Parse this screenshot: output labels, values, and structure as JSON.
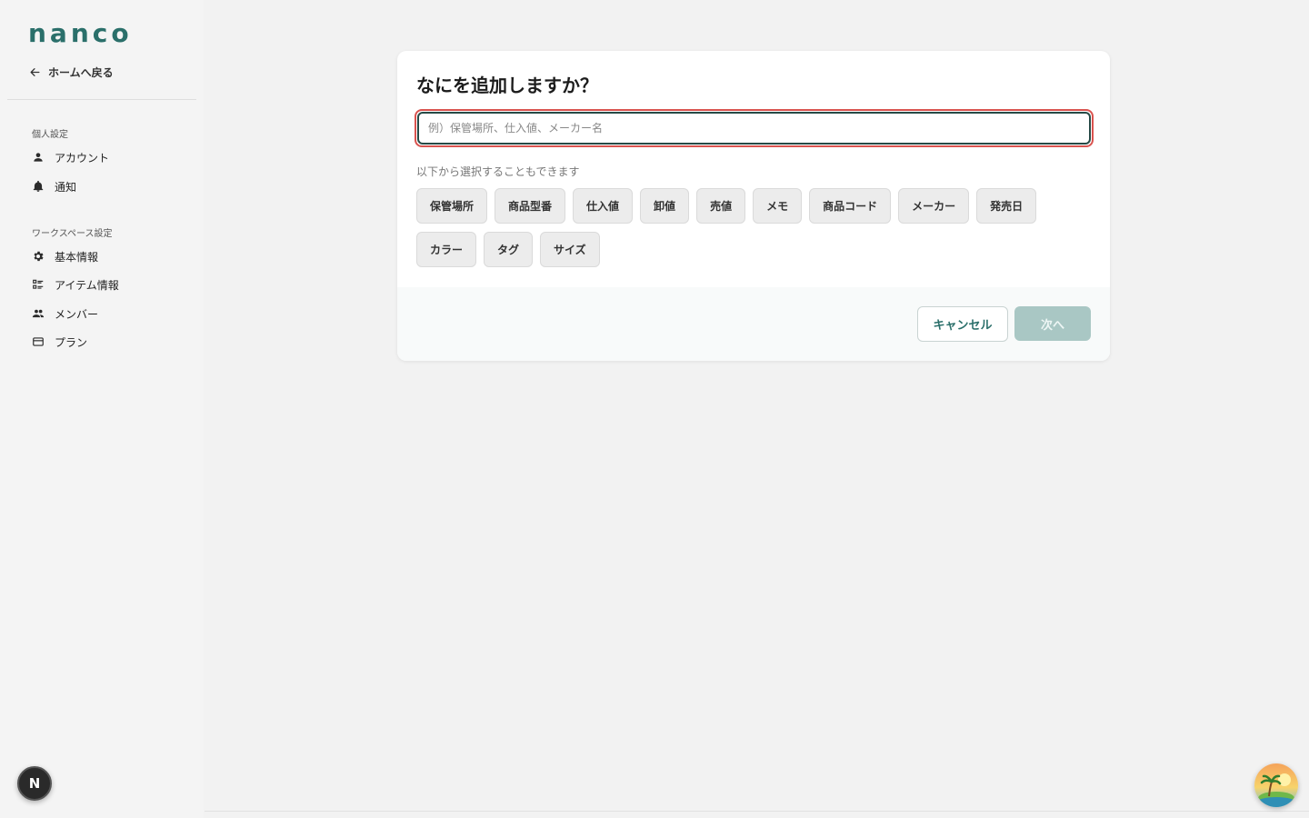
{
  "app": {
    "logo": "nanco"
  },
  "sidebar": {
    "back_label": "ホームへ戻る",
    "personal_section": "個人設定",
    "personal_items": [
      {
        "label": "アカウント",
        "icon": "person-icon"
      },
      {
        "label": "通知",
        "icon": "bell-icon"
      }
    ],
    "workspace_section": "ワークスペース設定",
    "workspace_items": [
      {
        "label": "基本情報",
        "icon": "gear-icon"
      },
      {
        "label": "アイテム情報",
        "icon": "list-icon"
      },
      {
        "label": "メンバー",
        "icon": "people-icon"
      },
      {
        "label": "プラン",
        "icon": "credit-card-icon"
      }
    ],
    "user_initial": "N"
  },
  "dialog": {
    "title": "なにを追加しますか？",
    "input_placeholder": "例）保管場所、仕入値、メーカー名",
    "input_value": "",
    "hint": "以下から選択することもできます",
    "chips": [
      "保管場所",
      "商品型番",
      "仕入値",
      "卸値",
      "売値",
      "メモ",
      "商品コード",
      "メーカー",
      "発売日",
      "カラー",
      "タグ",
      "サイズ"
    ],
    "cancel_label": "キャンセル",
    "next_label": "次へ"
  },
  "colors": {
    "brand": "#2a6f6a",
    "next_disabled": "#a9c7c4",
    "input_error_outline": "#d9534f"
  }
}
